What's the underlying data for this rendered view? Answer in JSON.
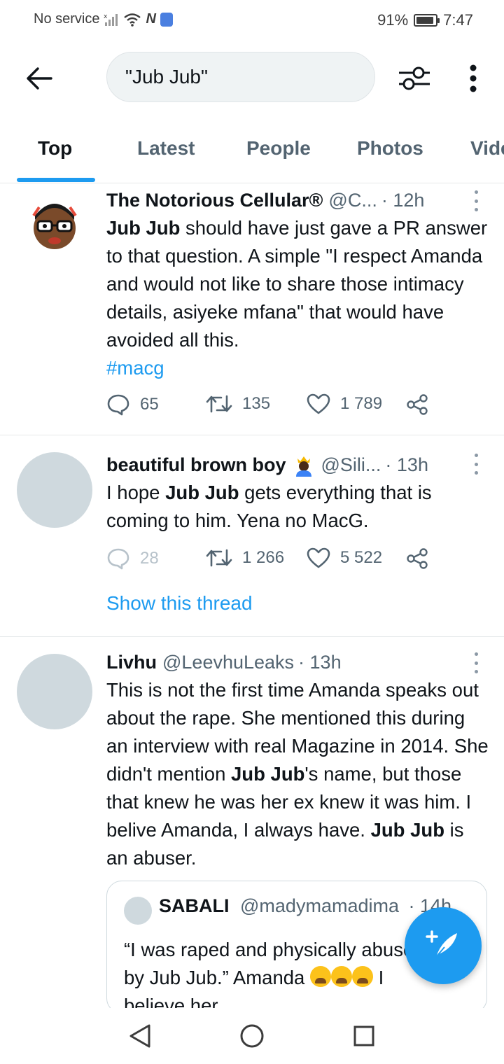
{
  "status_bar": {
    "carrier": "No service",
    "battery": "91%",
    "battery_level": 0.91,
    "time": "7:47"
  },
  "header": {
    "search_value": "\"Jub Jub\"",
    "icons": [
      "back-arrow-icon",
      "filter-sliders-icon",
      "more-vertical-icon"
    ]
  },
  "tabs": [
    {
      "label": "Top",
      "active": true
    },
    {
      "label": "Latest",
      "active": false
    },
    {
      "label": "People",
      "active": false
    },
    {
      "label": "Photos",
      "active": false
    },
    {
      "label": "Videos",
      "active": false
    }
  ],
  "tabs_visible": {
    "videos_truncated": "Vide"
  },
  "tweets": [
    {
      "name": "The Notorious Cellular®",
      "handle": "@C...",
      "time": "· 12h",
      "text_parts": [
        {
          "t": "Jub Jub",
          "bold": true
        },
        {
          "t": " should have just gave a PR answer to that question. A simple \"I respect Amanda and would not like to share those intimacy details, asiyeke mfana\" that would have avoided all this.",
          "bold": false
        }
      ],
      "hashtag": "#macg",
      "replies": "65",
      "retweets": "135",
      "likes": "1 789"
    },
    {
      "name": "beautiful brown boy",
      "handle": "@Sili...",
      "time": "· 13h",
      "text_parts": [
        {
          "t": "I hope ",
          "bold": false
        },
        {
          "t": "Jub Jub",
          "bold": true
        },
        {
          "t": " gets everything that is coming to him. Yena no MacG.",
          "bold": false
        }
      ],
      "replies": "28",
      "retweets": "1 266",
      "likes": "5 522",
      "show_thread": "Show this thread"
    },
    {
      "name": "Livhu",
      "handle": "@LeevhuLeaks",
      "time": "· 13h",
      "text_parts": [
        {
          "t": "This is not the first time Amanda speaks out about the rape. She mentioned this during an interview with real Magazine in 2014. She didn't mention ",
          "bold": false
        },
        {
          "t": "Jub Jub",
          "bold": true
        },
        {
          "t": "'s name, but those that knew he was her ex knew it was him. I belive Amanda, I always have. ",
          "bold": false
        },
        {
          "t": "Jub Jub",
          "bold": true
        },
        {
          "t": " is an abuser.",
          "bold": false
        }
      ],
      "quote": {
        "name": "SABALI",
        "handle": "@madymamadima",
        "time": "· 14h",
        "text_1": "“I was raped and physically abused",
        "text_2": "by Jub Jub.” Amanda",
        "text_3": "I",
        "text_4": "believe her"
      }
    }
  ],
  "colors": {
    "accent": "#1d9bf0",
    "text": "#0f1419",
    "secondary": "#536471",
    "divider": "#e6e9ea"
  }
}
